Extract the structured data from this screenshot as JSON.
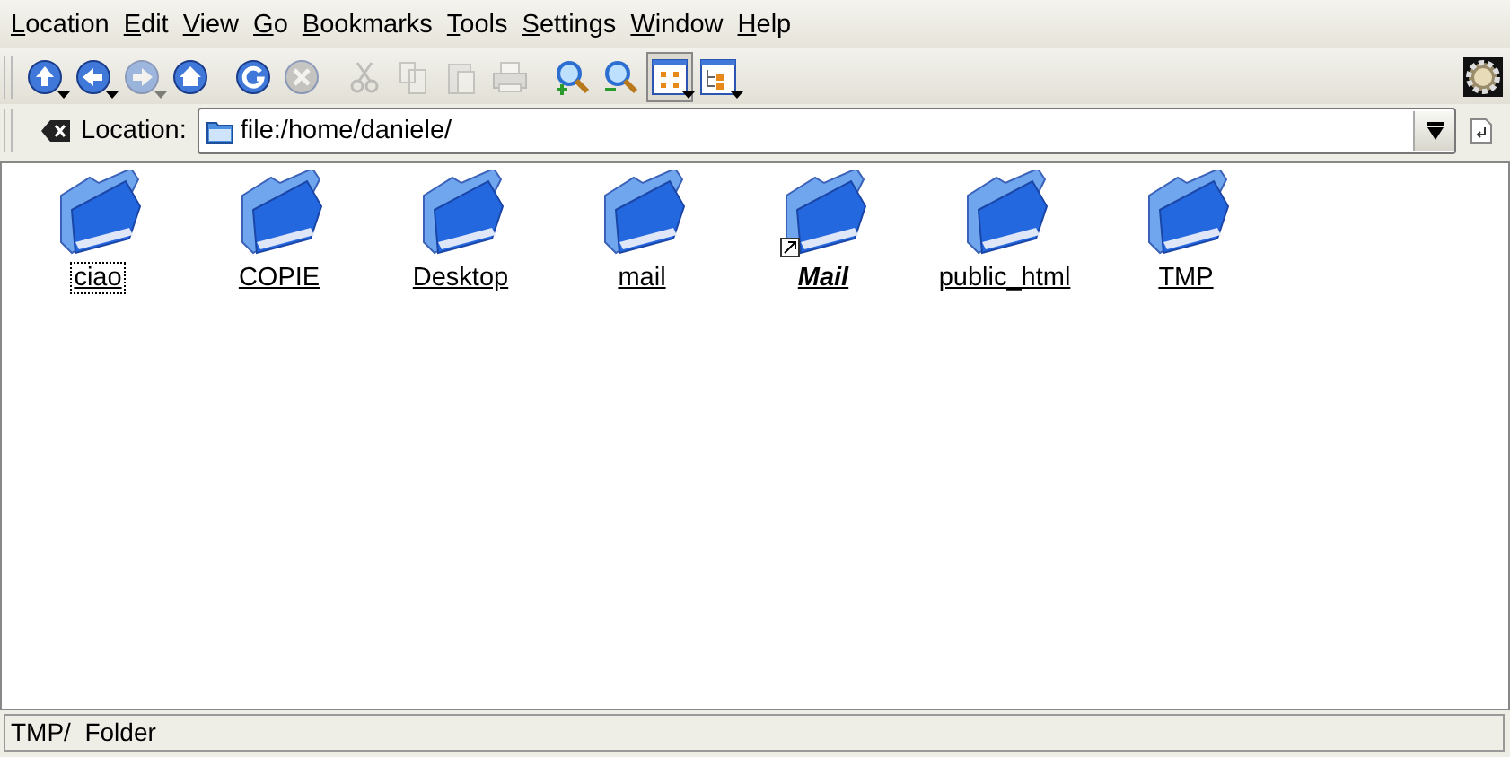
{
  "menu": [
    {
      "label": "Location"
    },
    {
      "label": "Edit"
    },
    {
      "label": "View"
    },
    {
      "label": "Go"
    },
    {
      "label": "Bookmarks"
    },
    {
      "label": "Tools"
    },
    {
      "label": "Settings"
    },
    {
      "label": "Window"
    },
    {
      "label": "Help"
    }
  ],
  "toolbar": [
    {
      "kind": "up",
      "disabled": false,
      "dropdown": true
    },
    {
      "kind": "back",
      "disabled": false,
      "dropdown": true
    },
    {
      "kind": "forward",
      "disabled": true,
      "dropdown": true
    },
    {
      "kind": "home",
      "disabled": false,
      "dropdown": false
    },
    {
      "kind": "reload",
      "disabled": false,
      "dropdown": false
    },
    {
      "kind": "stop",
      "disabled": true,
      "dropdown": false
    },
    {
      "kind": "cut",
      "disabled": true,
      "dropdown": false
    },
    {
      "kind": "copy",
      "disabled": true,
      "dropdown": false
    },
    {
      "kind": "paste",
      "disabled": true,
      "dropdown": false
    },
    {
      "kind": "print",
      "disabled": true,
      "dropdown": false
    },
    {
      "kind": "zoomin",
      "disabled": false,
      "dropdown": false
    },
    {
      "kind": "zoomout",
      "disabled": false,
      "dropdown": false
    },
    {
      "kind": "iconview",
      "disabled": false,
      "dropdown": true,
      "pressed": true
    },
    {
      "kind": "treeview",
      "disabled": false,
      "dropdown": true,
      "pressed": false
    }
  ],
  "location": {
    "label": "Location:",
    "value": "file:/home/daniele/"
  },
  "files": [
    {
      "name": "ciao",
      "kind": "folder",
      "focused": true
    },
    {
      "name": "COPIE",
      "kind": "folder",
      "focused": false
    },
    {
      "name": "Desktop",
      "kind": "folder",
      "focused": false
    },
    {
      "name": "mail",
      "kind": "folder",
      "focused": false
    },
    {
      "name": "Mail",
      "kind": "link",
      "focused": false
    },
    {
      "name": "public_html",
      "kind": "folder",
      "focused": false
    },
    {
      "name": "TMP",
      "kind": "folder",
      "focused": false
    }
  ],
  "status_bar": "TMP/  Folder"
}
